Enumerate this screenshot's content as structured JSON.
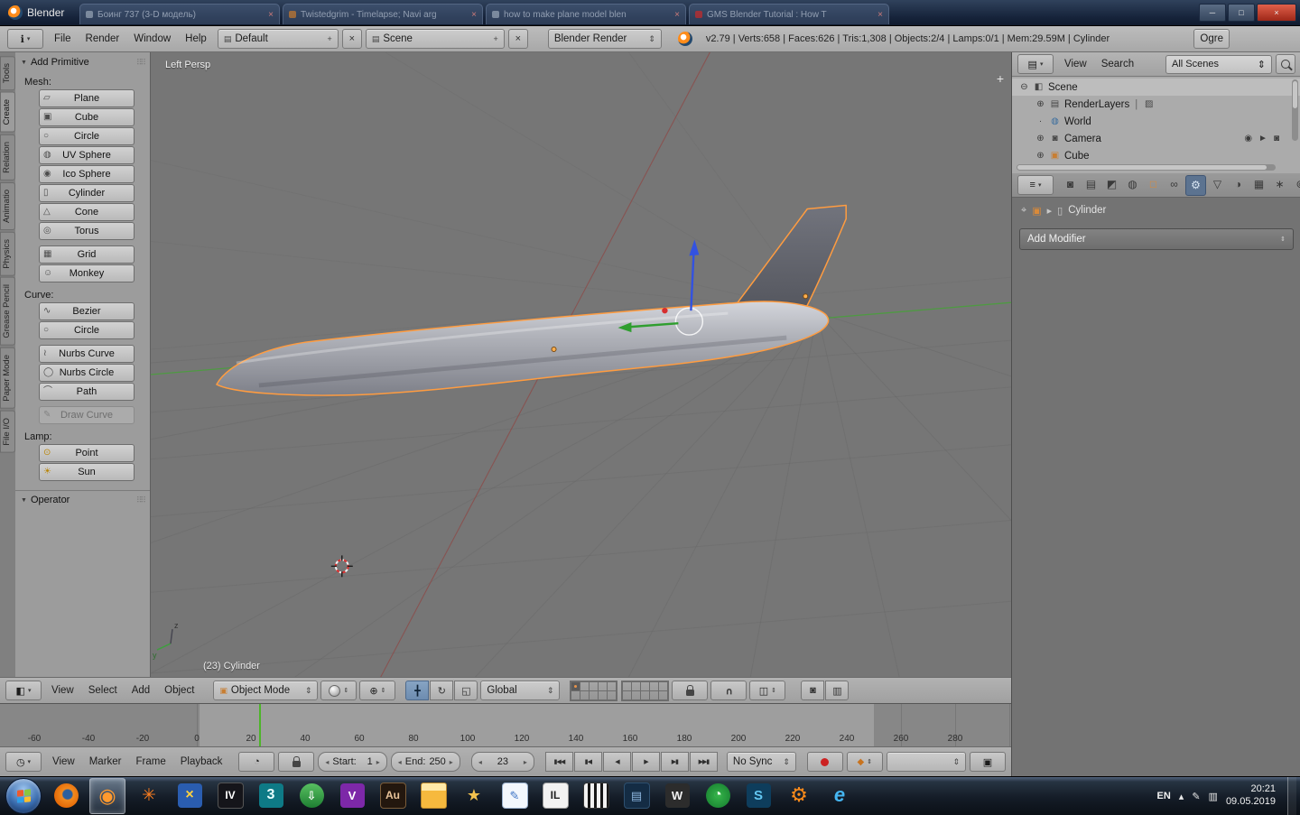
{
  "window": {
    "title": "Blender",
    "ghost_close_glyph": "×",
    "minimize_glyph": "─",
    "maximize_glyph": "□",
    "close_glyph": "×",
    "ghost_tabs": [
      {
        "label": "Боинг 737 (3-D модель)",
        "favicon_css": "background:#9aa7b8"
      },
      {
        "label": "Twistedgrim - Timelapse; Navi arg",
        "favicon_css": "background:#c97b2d"
      },
      {
        "label": "how to make plane model blen",
        "favicon_css": "background:#9aa7b8"
      },
      {
        "label": "GMS Blender Tutorial : How T",
        "favicon_css": "background:#cc2a2a"
      }
    ]
  },
  "info_header": {
    "editor_icon": "ℹ",
    "menus": [
      {
        "name": "menu-file",
        "label": "File"
      },
      {
        "name": "menu-render",
        "label": "Render"
      },
      {
        "name": "menu-window",
        "label": "Window"
      },
      {
        "name": "menu-help",
        "label": "Help"
      }
    ],
    "icons": {
      "browse": "▤",
      "add": "+",
      "clear": "×"
    },
    "layout_value": "Default",
    "scene_value": "Scene",
    "engine_value": "Blender Render",
    "stats": "v2.79 | Verts:658 | Faces:626 | Tris:1,308 | Objects:2/4 | Lamps:0/1 | Mem:29.59M | Cylinder",
    "ogre_label": "Ogre"
  },
  "tool_shelf": {
    "drag_glyph": "⠿⠿",
    "tabs": [
      {
        "label": "Tools"
      },
      {
        "label": "Create",
        "active": true
      },
      {
        "label": "Relation"
      },
      {
        "label": "Animatio"
      },
      {
        "label": "Physics"
      },
      {
        "label": "Grease Pencil"
      },
      {
        "label": "Paper Mode"
      },
      {
        "label": "File I/O"
      }
    ],
    "panel_title": "Add Primitive",
    "mesh_label": "Mesh:",
    "mesh_buttons_a": [
      {
        "name": "add-plane-button",
        "icon": "▱",
        "label": "Plane"
      },
      {
        "name": "add-cube-button",
        "icon": "▣",
        "label": "Cube"
      },
      {
        "name": "add-circle-button",
        "icon": "○",
        "label": "Circle"
      },
      {
        "name": "add-uv-sphere-button",
        "icon": "◍",
        "label": "UV Sphere"
      },
      {
        "name": "add-ico-sphere-button",
        "icon": "◉",
        "label": "Ico Sphere"
      },
      {
        "name": "add-cylinder-button",
        "icon": "▯",
        "label": "Cylinder"
      },
      {
        "name": "add-cone-button",
        "icon": "△",
        "label": "Cone"
      },
      {
        "name": "add-torus-button",
        "icon": "◎",
        "label": "Torus"
      }
    ],
    "mesh_buttons_b": [
      {
        "name": "add-grid-button",
        "icon": "▦",
        "label": "Grid"
      },
      {
        "name": "add-monkey-button",
        "icon": "☺",
        "label": "Monkey"
      }
    ],
    "curve_label": "Curve:",
    "curve_buttons_a": [
      {
        "name": "add-bezier-button",
        "icon": "∿",
        "label": "Bezier"
      },
      {
        "name": "add-curve-circle-button",
        "icon": "○",
        "label": "Circle"
      }
    ],
    "curve_buttons_b": [
      {
        "name": "add-nurbs-curve-button",
        "icon": "≀",
        "label": "Nurbs Curve"
      },
      {
        "name": "add-nurbs-circle-button",
        "icon": "◯",
        "label": "Nurbs Circle"
      },
      {
        "name": "add-path-button",
        "icon": "⌒",
        "label": "Path"
      }
    ],
    "curve_buttons_c": [
      {
        "name": "draw-curve-button",
        "icon": "✎",
        "label": "Draw Curve",
        "disabled": true
      }
    ],
    "lamp_label": "Lamp:",
    "lamp_buttons": [
      {
        "name": "add-point-lamp-button",
        "icon": "⊙",
        "label": "Point"
      },
      {
        "name": "add-sun-lamp-button",
        "icon": "☀",
        "label": "Sun"
      }
    ],
    "operator_title": "Operator"
  },
  "viewport": {
    "view_label": "Left Persp",
    "object_label": "(23) Cylinder",
    "region_plus": "+",
    "selected_outline_color": "#ff9c40"
  },
  "viewport_header": {
    "editor_icon": "◧",
    "menus": [
      {
        "name": "menu-view",
        "label": "View"
      },
      {
        "name": "menu-select",
        "label": "Select"
      },
      {
        "name": "menu-add",
        "label": "Add"
      },
      {
        "name": "menu-object",
        "label": "Object"
      }
    ],
    "mode_value": "Object Mode",
    "orientation_value": "Global",
    "icons": {
      "mode": "▣",
      "pivot": "⊕",
      "translate": "╋",
      "rotate": "↻",
      "scale": "◱",
      "magnet": "∪",
      "snap": "◫",
      "camera": "◙",
      "clapper": "▥"
    }
  },
  "timeline": {
    "editor_icon": "◷",
    "menus": [
      {
        "name": "menu-view",
        "label": "View"
      },
      {
        "name": "menu-marker",
        "label": "Marker"
      },
      {
        "name": "menu-frame",
        "label": "Frame"
      },
      {
        "name": "menu-playback",
        "label": "Playback"
      }
    ],
    "ruler_labels": [
      "-60",
      "-40",
      "-20",
      "0",
      "20",
      "40",
      "60",
      "80",
      "100",
      "120",
      "140",
      "160",
      "180",
      "200",
      "220",
      "240",
      "260",
      "280"
    ],
    "preview_icon": "◔",
    "start_label": "Start:",
    "start_value": "1",
    "end_label": "End:",
    "end_value": "250",
    "current_frame": "23",
    "transport": [
      {
        "name": "jump-to-start-button",
        "glyph": "▮◀◀"
      },
      {
        "name": "jump-to-prev-keyframe-button",
        "glyph": "▮◀"
      },
      {
        "name": "play-reverse-button",
        "glyph": "◀"
      },
      {
        "name": "play-button",
        "glyph": "▶"
      },
      {
        "name": "jump-to-next-keyframe-button",
        "glyph": "▶▮"
      },
      {
        "name": "jump-to-end-button",
        "glyph": "▶▶▮"
      }
    ],
    "sync_value": "No Sync",
    "key_icon": "◆",
    "copy_icon": "▣"
  },
  "outliner": {
    "editor_icon": "▤",
    "menus": [
      {
        "name": "menu-view",
        "label": "View"
      },
      {
        "name": "menu-search",
        "label": "Search"
      }
    ],
    "scope_value": "All Scenes",
    "icons": {
      "minus": "⊖",
      "plus": "⊕",
      "dot": "·",
      "scene": "◧",
      "renderlayers": "▤",
      "render_result": "▨",
      "world": "◍",
      "camera": "◙",
      "mesh": "▣",
      "pipe": "|",
      "eye": "◉",
      "pointer": "►",
      "cam_restrict": "◙"
    },
    "rows": {
      "scene": "Scene",
      "renderlayers": "RenderLayers",
      "world": "World",
      "camera": "Camera",
      "cube": "Cube"
    }
  },
  "properties": {
    "editor_icon": "≡",
    "tabs": [
      {
        "name": "render-tab",
        "glyph": "◙"
      },
      {
        "name": "render-layers-tab",
        "glyph": "▤"
      },
      {
        "name": "scene-tab",
        "glyph": "◩"
      },
      {
        "name": "world-tab",
        "glyph": "◍"
      },
      {
        "name": "object-tab",
        "glyph": "□",
        "css": "color:#d98a3a"
      },
      {
        "name": "constraints-tab",
        "glyph": "∞"
      },
      {
        "name": "modifiers-tab",
        "glyph": "⚙",
        "active": true
      },
      {
        "name": "data-tab",
        "glyph": "▽"
      },
      {
        "name": "material-tab",
        "glyph": "◑"
      },
      {
        "name": "texture-tab",
        "glyph": "▦"
      },
      {
        "name": "particles-tab",
        "glyph": "∗"
      },
      {
        "name": "physics-tab",
        "glyph": "⊚"
      }
    ],
    "icons": {
      "pin": "⌖",
      "object": "▣",
      "arrow": "▸",
      "data": "▯"
    },
    "breadcrumb_object": "Cylinder",
    "add_modifier_label": "Add Modifier"
  },
  "taskbar": {
    "icons": [
      {
        "name": "firefox-icon",
        "glyph": "",
        "css": "background:radial-gradient(circle at 55% 45%, #2b5f9e 0 24%, #f28a1e 30%, #e05e00 85%);border-radius:50%"
      },
      {
        "name": "blender-icon",
        "glyph": "◉",
        "css": "color:#ff9a2e;font-size:22px",
        "active": true
      },
      {
        "name": "orange-star-app-icon",
        "glyph": "✳",
        "css": "color:#ff7f1f;font-size:19px"
      },
      {
        "name": "xpadder-icon",
        "glyph": "×",
        "css": "background:#2a5db0;color:#ffd23e;font-size:16px"
      },
      {
        "name": "gta-iv-icon",
        "glyph": "IV",
        "css": "background:#15151a;color:#ffffff;border:1px solid #555;font-size:12px"
      },
      {
        "name": "3ds-max-icon",
        "glyph": "3",
        "css": "background:#0e7a86;color:#eaffff;font-size:16px"
      },
      {
        "name": "idm-icon",
        "glyph": "⇩",
        "css": "background:linear-gradient(#58c061,#1e7e32);color:#fff;border-radius:50%"
      },
      {
        "name": "vegas-icon",
        "glyph": "V",
        "css": "background:#7d28a8;color:#ffffff"
      },
      {
        "name": "audition-icon",
        "glyph": "Au",
        "css": "background:#23170e;color:#e8c39a;border:1px solid #7a5c3a;font-size:12px"
      },
      {
        "name": "explorer-folder-icon",
        "glyph": "",
        "css": "background:linear-gradient(180deg,#ffe9a8 0 30%,#f6b93e 30%);border-radius:3px;border:1px solid #b9862a"
      },
      {
        "name": "gold-tool-icon",
        "glyph": "★",
        "css": "color:#f2c14e;font-size:18px"
      },
      {
        "name": "wordpad-icon",
        "glyph": "✎",
        "css": "background:#f3f7fc;color:#3b72c4;border:1px solid #9ab0cc"
      },
      {
        "name": "image-line-icon",
        "glyph": "IL",
        "css": "background:#f2f2f2;color:#222;font-size:12px;border:1px solid #999"
      },
      {
        "name": "midi-keyboard-icon",
        "glyph": "",
        "css": "background:repeating-linear-gradient(90deg,#f2f2f2 0 4px,#161616 4px 7px);border:1px solid #333"
      },
      {
        "name": "synth-icon",
        "glyph": "▤",
        "css": "background:#142c44;color:#8fb8e0;border:1px solid #2e5070"
      },
      {
        "name": "wacom-icon",
        "glyph": "W",
        "css": "background:#2c2c2c;color:#f2f2f2"
      },
      {
        "name": "green-gauge-icon",
        "glyph": "◔",
        "css": "background:radial-gradient(#35b54a,#157a2e);color:#eaffea;border-radius:50%;font-size:16px"
      },
      {
        "name": "s-app-icon",
        "glyph": "S",
        "css": "background:#0e3d5c;color:#63c7f2;font-size:15px"
      },
      {
        "name": "gear-app-icon",
        "glyph": "⚙",
        "css": "color:#ff8c1a;font-size:22px"
      },
      {
        "name": "ie-icon",
        "glyph": "e",
        "css": "color:#45b6f2;font-size:22px;font-style:italic"
      }
    ],
    "tray": {
      "lang": "EN",
      "hidden_icons": "▴",
      "pen": "✎",
      "network": "▥",
      "time": "20:21",
      "date": "09.05.2019"
    }
  }
}
